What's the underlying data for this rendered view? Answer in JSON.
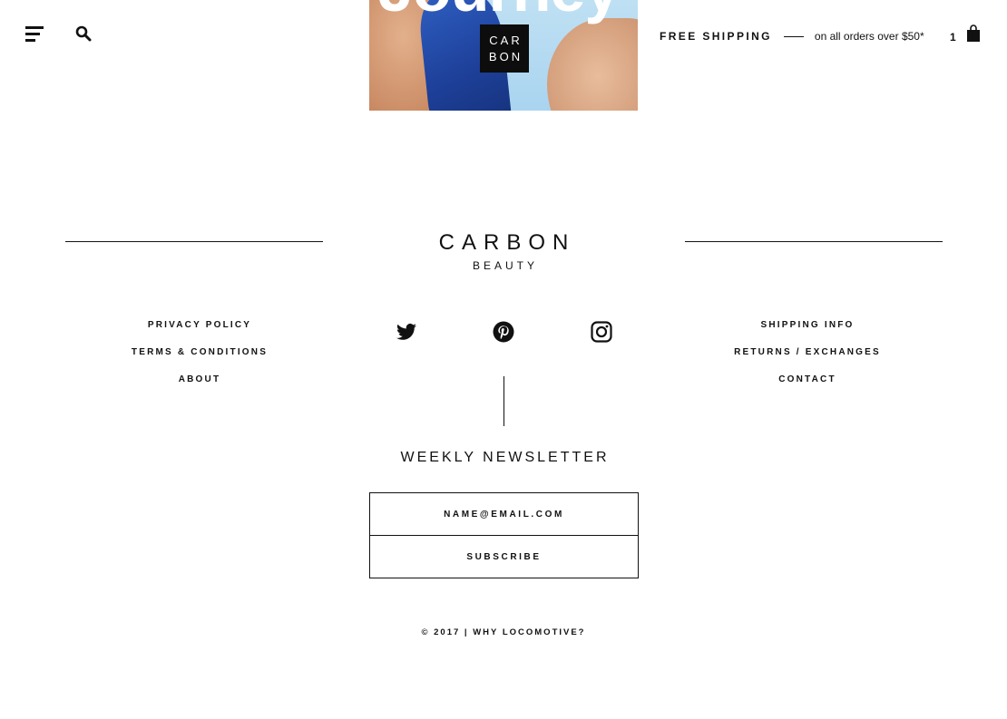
{
  "hero": {
    "overlay_text": "Journey",
    "badge_line_1": "CAR",
    "badge_line_2": "BON"
  },
  "header": {
    "menu_icon": "hamburger-menu-icon",
    "search_icon": "search-icon",
    "shipping_title": "FREE SHIPPING",
    "shipping_note": "on all orders over $50*",
    "cart_count": "1",
    "cart_icon": "shopping-bag-icon"
  },
  "footer": {
    "logo_word": "CARBON",
    "logo_sub": "BEAUTY",
    "left_links": [
      "PRIVACY POLICY",
      "TERMS & CONDITIONS",
      "ABOUT"
    ],
    "right_links": [
      "SHIPPING INFO",
      "RETURNS / EXCHANGES",
      "CONTACT"
    ],
    "social": [
      "twitter-icon",
      "pinterest-icon",
      "instagram-icon"
    ],
    "newsletter_title": "WEEKLY NEWSLETTER",
    "email_placeholder": "NAME@EMAIL.COM",
    "subscribe_label": "SUBSCRIBE",
    "copyright": "© 2017 | WHY LOCOMOTIVE?"
  },
  "colors": {
    "text": "#111111",
    "background": "#ffffff",
    "hero_sky": "#a9d4f0",
    "swimsuit_blue": "#1d3f98"
  }
}
